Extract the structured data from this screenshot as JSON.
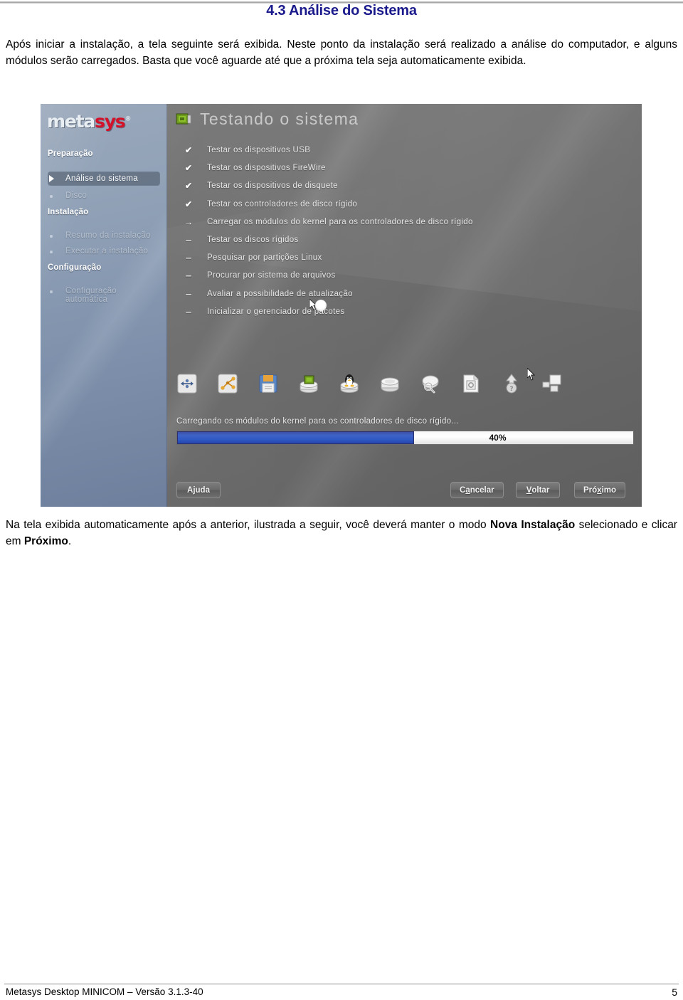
{
  "document": {
    "heading": "4.3 Análise do Sistema",
    "paragraph_intro": "Após iniciar a instalação, a tela seguinte será exibida. Neste ponto da instalação será realizado a análise do computador, e alguns módulos serão carregados. Basta que você aguarde até que a próxima tela seja automaticamente exibida.",
    "paragraph_after_prefix": "Na tela exibida automaticamente após a anterior, ilustrada a seguir, você deverá manter o modo ",
    "paragraph_after_bold1": "Nova Instalação",
    "paragraph_after_middle": " selecionado e clicar em ",
    "paragraph_after_bold2": "Próximo",
    "paragraph_after_suffix": ".",
    "footer_text": "Metasys Desktop MINICOM – Versão 3.1.3-40",
    "page_number": "5"
  },
  "installer": {
    "logo": {
      "part1": "meta",
      "part2": "sys",
      "trademark": "®"
    },
    "title": "Testando o sistema",
    "title_icon": "chip-card-icon",
    "sidebar": {
      "groups": [
        {
          "label": "Preparação"
        },
        {
          "label": "Instalação"
        },
        {
          "label": "Configuração"
        }
      ],
      "items": [
        {
          "label": "Análise do sistema",
          "state": "active",
          "marker": "arrow"
        },
        {
          "label": "Disco",
          "state": "pending",
          "marker": "bullet"
        },
        {
          "label": "Resumo da instalação",
          "state": "pending",
          "marker": "bullet"
        },
        {
          "label": "Executar a instalação",
          "state": "pending",
          "marker": "bullet"
        },
        {
          "label": "Configuração automática",
          "state": "pending",
          "marker": "bullet"
        }
      ]
    },
    "tasks": [
      {
        "mark": "✔",
        "label": "Testar os dispositivos USB",
        "state": "done"
      },
      {
        "mark": "✔",
        "label": "Testar os dispositivos FireWire",
        "state": "done"
      },
      {
        "mark": "✔",
        "label": "Testar os dispositivos de disquete",
        "state": "done"
      },
      {
        "mark": "✔",
        "label": "Testar os controladores de disco rígido",
        "state": "done"
      },
      {
        "mark": "→",
        "label": "Carregar os módulos do kernel para os controladores de disco rígido",
        "state": "current"
      },
      {
        "mark": "–",
        "label": "Testar os discos rígidos",
        "state": "pending"
      },
      {
        "mark": "–",
        "label": "Pesquisar por partições Linux",
        "state": "pending"
      },
      {
        "mark": "–",
        "label": "Procurar por sistema de arquivos",
        "state": "pending"
      },
      {
        "mark": "–",
        "label": "Avaliar a possibilidade de atualização",
        "state": "pending"
      },
      {
        "mark": "–",
        "label": "Inicializar o gerenciador de pacotes",
        "state": "pending"
      }
    ],
    "device_icons": [
      "usb-device-icon",
      "firewire-device-icon",
      "floppy-disk-icon",
      "disk-controller-chip-icon",
      "linux-penguin-disk-icon",
      "hard-disk-icon",
      "partition-search-icon",
      "filesystem-document-icon",
      "upgrade-question-icon",
      "package-manager-icon"
    ],
    "progress": {
      "label": "Carregando os módulos do kernel para os controladores de disco rígido...",
      "percent_text": "40%",
      "percent_value": 40,
      "fill_color": "#3157c2"
    },
    "buttons": {
      "help": {
        "before": "A",
        "accel": "j",
        "after": "uda"
      },
      "cancel": {
        "before": "C",
        "accel": "a",
        "after": "ncelar"
      },
      "back": {
        "before": "",
        "accel": "V",
        "after": "oltar"
      },
      "next": {
        "before": "Pró",
        "accel": "x",
        "after": "imo"
      }
    }
  },
  "colors": {
    "heading": "#1a1a8c",
    "logo_accent": "#d4122a",
    "progress_blue": "#3157c2",
    "sidebar_blue": "#8fa0b6"
  }
}
